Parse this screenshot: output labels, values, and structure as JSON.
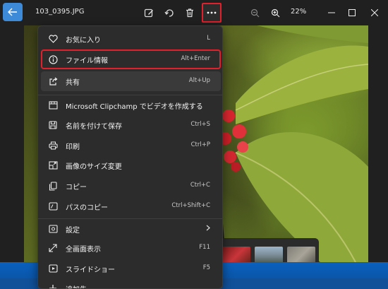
{
  "titlebar": {
    "filename": "103_0395.JPG",
    "zoom_level": "22%",
    "icons": [
      "back-arrow-icon",
      "edit-icon",
      "rotate-icon",
      "delete-icon",
      "more-icon",
      "zoom-out-icon",
      "zoom-in-icon",
      "minimize-icon",
      "maximize-icon",
      "close-icon"
    ]
  },
  "menu": {
    "items": [
      {
        "label": "お気に入り",
        "shortcut": "L",
        "icon": "heart-icon"
      },
      {
        "label": "ファイル情報",
        "shortcut": "Alt+Enter",
        "icon": "info-icon"
      },
      {
        "label": "共有",
        "shortcut": "Alt+Up",
        "icon": "share-icon"
      },
      {
        "label": "Microsoft Clipchamp でビデオを作成する",
        "shortcut": "",
        "icon": "clipchamp-icon"
      },
      {
        "label": "名前を付けて保存",
        "shortcut": "Ctrl+S",
        "icon": "save-icon"
      },
      {
        "label": "印刷",
        "shortcut": "Ctrl+P",
        "icon": "print-icon"
      },
      {
        "label": "画像のサイズ変更",
        "shortcut": "",
        "icon": "resize-icon"
      },
      {
        "label": "コピー",
        "shortcut": "Ctrl+C",
        "icon": "copy-icon"
      },
      {
        "label": "パスのコピー",
        "shortcut": "Ctrl+Shift+C",
        "icon": "copy-path-icon"
      },
      {
        "label": "設定",
        "shortcut": "",
        "icon": "settings-icon"
      },
      {
        "label": "全画面表示",
        "shortcut": "F11",
        "icon": "fullscreen-icon"
      },
      {
        "label": "スライドショー",
        "shortcut": "F5",
        "icon": "slideshow-icon"
      },
      {
        "label": "追加先",
        "shortcut": "",
        "icon": "add-icon"
      }
    ]
  },
  "colors": {
    "accent": "#3c8ad8",
    "highlight_border": "#e0202a",
    "menu_bg": "#2c2c2c"
  }
}
